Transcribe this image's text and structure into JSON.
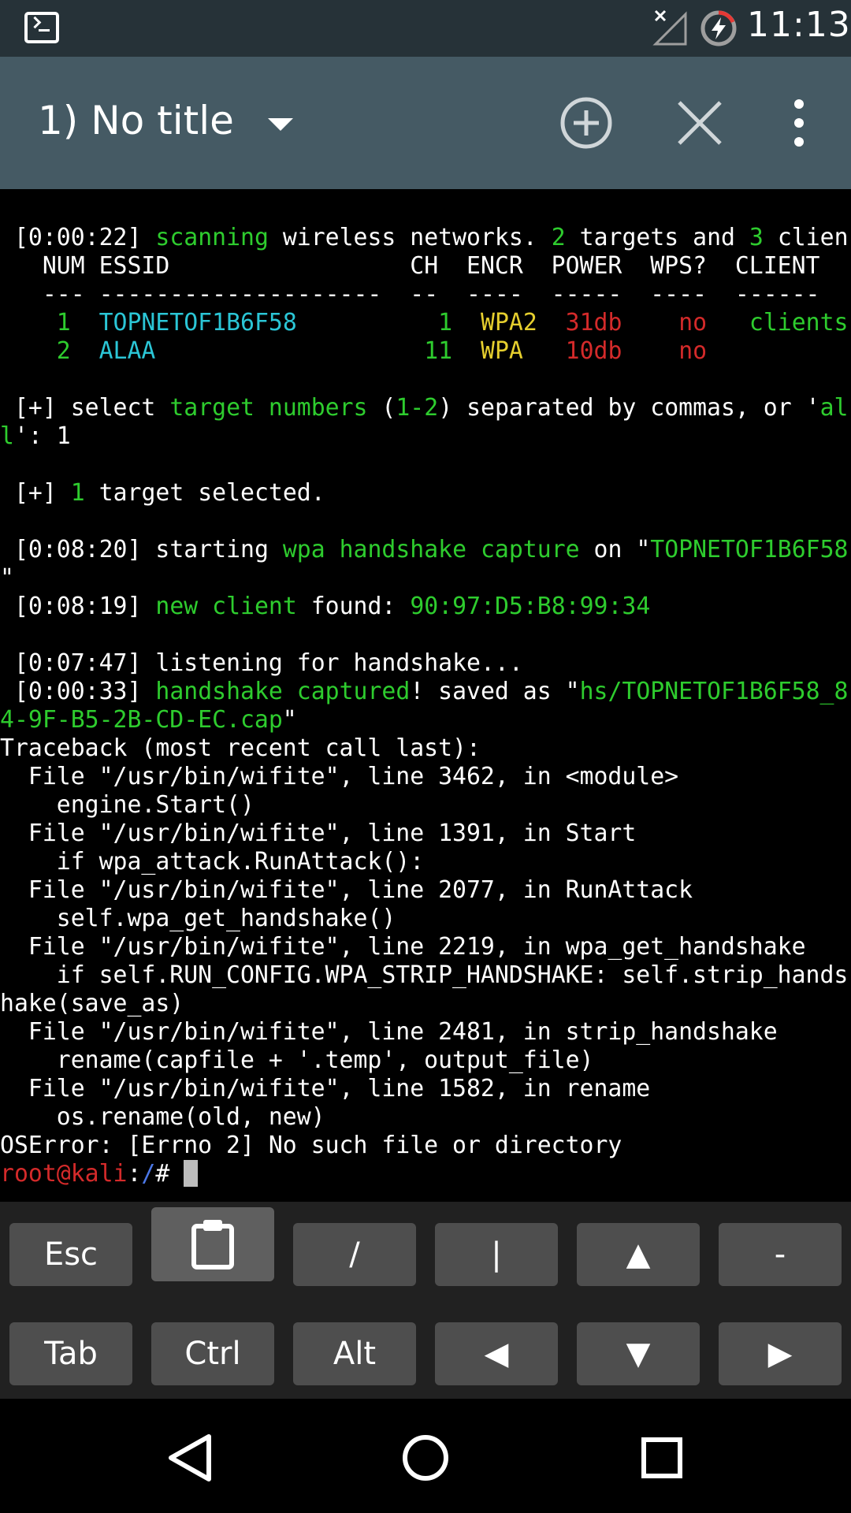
{
  "status_bar": {
    "time": "11:13",
    "icons": [
      "terminal-app-icon",
      "no-signal-icon",
      "battery-charging-icon"
    ]
  },
  "toolbar": {
    "title": "1) No title",
    "icons": [
      "dropdown-arrow-icon",
      "add-session-icon",
      "close-session-icon",
      "overflow-menu-icon"
    ]
  },
  "terminal": {
    "scan_time": "[0:00:22]",
    "scan_word": "scanning",
    "scan_mid": "wireless networks.",
    "targets_count": "2",
    "targets_word": "targets and",
    "clients_count": "3",
    "clients_word": "clien",
    "table_header": "  NUM ESSID                 CH  ENCR  POWER  WPS?  CLIENT",
    "table_rule": "  --- --------------------  --  ----  -----  ----  ------",
    "rows": [
      {
        "num": "1",
        "essid": "TOPNETOF1B6F58",
        "ch": "1",
        "encr": "WPA2",
        "power": "31db",
        "wps": "no",
        "client": "clients"
      },
      {
        "num": "2",
        "essid": "ALAA",
        "ch": "11",
        "encr": "WPA",
        "power": "10db",
        "wps": "no",
        "client": ""
      }
    ],
    "select_prefix": "[+] select",
    "select_target": "target numbers",
    "select_range": "1-2",
    "select_rest": "separated by commas, or '",
    "select_all_a": "al",
    "select_all_b": "l",
    "select_answer": "': 1",
    "selected_prefix": "[+]",
    "selected_count": "1",
    "selected_rest": "target selected.",
    "start_time": "[0:08:20]",
    "start_word": "starting",
    "start_cap": "wpa handshake capture",
    "start_on": "on \"",
    "start_essid": "TOPNETOF1B6F58",
    "start_quote": "\"",
    "client_time": "[0:08:19]",
    "client_new": "new client",
    "client_found": "found:",
    "client_mac": "90:97:D5:B8:99:34",
    "listen_time": "[0:07:47]",
    "listen_text": "listening for handshake...",
    "cap_time": "[0:00:33]",
    "cap_word": "handshake captured",
    "cap_saved": "! saved as \"",
    "cap_file_a": "hs/TOPNETOF1B6F58_8",
    "cap_file_b": "4-9F-B5-2B-CD-EC.cap",
    "cap_end": "\"",
    "traceback": [
      "Traceback (most recent call last):",
      "  File \"/usr/bin/wifite\", line 3462, in <module>",
      "    engine.Start()",
      "  File \"/usr/bin/wifite\", line 1391, in Start",
      "    if wpa_attack.RunAttack():",
      "  File \"/usr/bin/wifite\", line 2077, in RunAttack",
      "    self.wpa_get_handshake()",
      "  File \"/usr/bin/wifite\", line 2219, in wpa_get_handshake",
      "    if self.RUN_CONFIG.WPA_STRIP_HANDSHAKE: self.strip_hands",
      "hake(save_as)",
      "  File \"/usr/bin/wifite\", line 2481, in strip_handshake",
      "    rename(capfile + '.temp', output_file)",
      "  File \"/usr/bin/wifite\", line 1582, in rename",
      "    os.rename(old, new)",
      "OSError: [Errno 2] No such file or directory"
    ],
    "prompt_user": "root@kali",
    "prompt_colon": ":",
    "prompt_path": "/",
    "prompt_hash": "# "
  },
  "extra_keys": {
    "row1": [
      "Esc",
      "clipboard-icon",
      "/",
      "|",
      "▲",
      "-"
    ],
    "row2": [
      "Tab",
      "Ctrl",
      "Alt",
      "◀",
      "▼",
      "▶"
    ]
  },
  "nav_bar": {
    "icons": [
      "back-icon",
      "home-icon",
      "recents-icon"
    ]
  },
  "colors": {
    "status_bar": "#263238",
    "toolbar": "#455a64",
    "terminal_bg": "#000000",
    "green": "#2ecc2e",
    "cyan": "#2bc6d6",
    "yellow": "#e6cf2e",
    "red": "#d42a2a",
    "blue": "#4b77e6",
    "key_bg": "#4e4e4e"
  }
}
